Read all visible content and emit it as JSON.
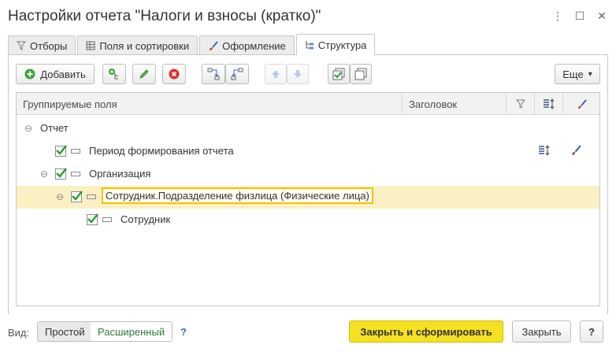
{
  "window": {
    "title": "Настройки отчета \"Налоги и взносы (кратко)\"",
    "menu_glyph": "⋮",
    "maximize_glyph": "☐",
    "close_glyph": "✕"
  },
  "tabs": [
    {
      "label": "Отборы",
      "icon": "funnel-icon",
      "active": false
    },
    {
      "label": "Поля и сортировки",
      "icon": "table-icon",
      "active": false
    },
    {
      "label": "Оформление",
      "icon": "brush-icon",
      "active": false
    },
    {
      "label": "Структура",
      "icon": "tree-icon",
      "active": true
    }
  ],
  "toolbar": {
    "add_label": "Добавить",
    "more_label": "Еще",
    "more_arrow": "▾"
  },
  "grid": {
    "columns": [
      "Группируемые поля",
      "Заголовок"
    ],
    "toggle_expanded": "⊖",
    "rows": [
      {
        "label": "Отчет",
        "checked": null
      },
      {
        "label": "Период формирования отчета",
        "checked": true
      },
      {
        "label": "Организация",
        "checked": true
      },
      {
        "label": "Сотрудник.Подразделение физлица (Физические лица)",
        "checked": true,
        "selected": true
      },
      {
        "label": "Сотрудник",
        "checked": true
      }
    ]
  },
  "footer": {
    "view_label": "Вид:",
    "simple_label": "Простой",
    "extended_label": "Расширенный",
    "help_mark": "?",
    "generate_label": "Закрыть и сформировать",
    "close_label": "Закрыть",
    "help_button": "?"
  },
  "colors": {
    "accent_yellow": "#f6e022",
    "selected_row": "#fbf0c4",
    "check_green": "#2a9d2a",
    "extended_text": "#2d7a3e"
  }
}
